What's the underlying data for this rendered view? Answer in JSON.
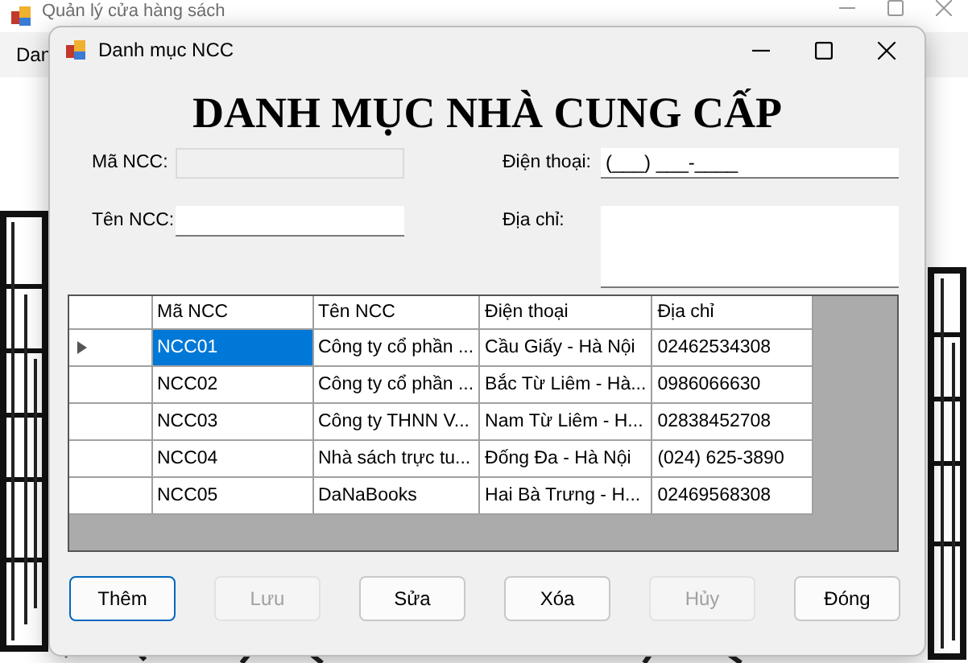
{
  "parent_window": {
    "title": "Quản lý cửa hàng sách",
    "menu": [
      {
        "label": "Dan"
      }
    ]
  },
  "dialog": {
    "title": "Danh mục NCC",
    "heading": "DANH MỤC NHÀ CUNG CẤP",
    "fields": [
      {
        "label": "Mã NCC:",
        "kind": "text",
        "disabled": true
      },
      {
        "label": "Điện thoại:",
        "kind": "masked",
        "value": "(___) ___-____",
        "disabled": false
      },
      {
        "label": "Tên NCC:",
        "kind": "text",
        "disabled": false
      },
      {
        "label": "Địa chỉ:",
        "kind": "multiline",
        "disabled": false
      }
    ],
    "table": {
      "columns": [
        "Mã NCC",
        "Tên NCC",
        "Điện thoại",
        "Địa chỉ"
      ],
      "rows": [
        {
          "selected": true,
          "cells": [
            "NCC01",
            "Công ty cổ phần ...",
            "Cầu Giấy - Hà Nội",
            "02462534308"
          ]
        },
        {
          "selected": false,
          "cells": [
            "NCC02",
            "Công ty cổ phần ...",
            "Bắc Từ Liêm - Hà...",
            "0986066630"
          ]
        },
        {
          "selected": false,
          "cells": [
            "NCC03",
            "Công ty THNN V...",
            "Nam Từ Liêm - H...",
            "02838452708"
          ]
        },
        {
          "selected": false,
          "cells": [
            "NCC04",
            "Nhà sách trực tu...",
            "Đống Đa - Hà Nội",
            "(024) 625-3890"
          ]
        },
        {
          "selected": false,
          "cells": [
            "NCC05",
            "DaNaBooks",
            "Hai Bà Trưng - H...",
            "02469568308"
          ]
        }
      ]
    },
    "buttons": [
      {
        "label": "Thêm",
        "disabled": false,
        "focused": true
      },
      {
        "label": "Lưu",
        "disabled": true,
        "focused": false
      },
      {
        "label": "Sửa",
        "disabled": false,
        "focused": false
      },
      {
        "label": "Xóa",
        "disabled": false,
        "focused": false
      },
      {
        "label": "Hủy",
        "disabled": true,
        "focused": false
      },
      {
        "label": "Đóng",
        "disabled": false,
        "focused": false
      }
    ]
  }
}
